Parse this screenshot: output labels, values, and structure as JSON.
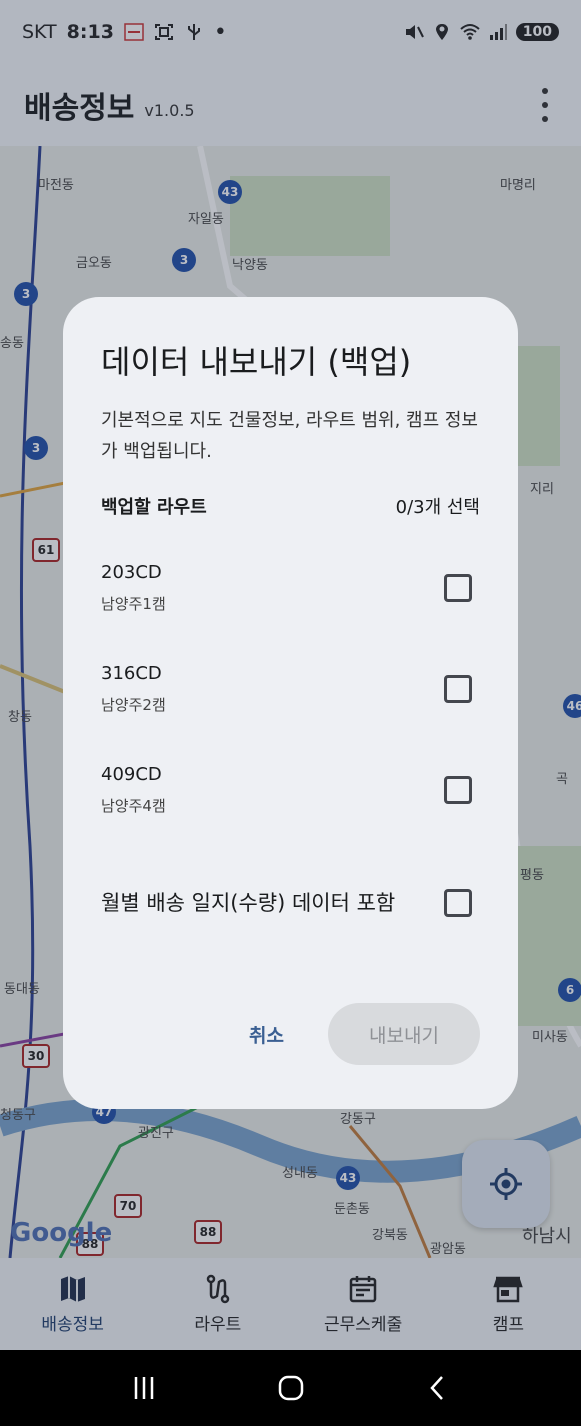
{
  "status_bar": {
    "carrier": "SKT",
    "time": "8:13",
    "battery": "100"
  },
  "app_bar": {
    "title": "배송정보",
    "version": "v1.0.5"
  },
  "map": {
    "labels": [
      "마전동",
      "자일동",
      "금오동",
      "낙양동",
      "마명리",
      "송동",
      "창동",
      "동대동",
      "광진구",
      "강동구",
      "성내동",
      "둔촌동",
      "강북동",
      "광암동",
      "미사동",
      "곡",
      "하남시",
      "지리",
      "평동",
      "청동구",
      "46",
      "6"
    ],
    "routes": [
      "43",
      "3",
      "3",
      "3",
      "43"
    ],
    "highways": [
      "61",
      "30",
      "70",
      "88",
      "88",
      "47"
    ],
    "google": "Google"
  },
  "dialog": {
    "title": "데이터 내보내기 (백업)",
    "description": "기본적으로 지도 건물정보, 라우트 범위, 캠프 정보가 백업됩니다.",
    "routes_label": "백업할 라우트",
    "selected_count": "0/3개 선택",
    "routes": [
      {
        "code": "203CD",
        "camp": "남양주1캠"
      },
      {
        "code": "316CD",
        "camp": "남양주2캠"
      },
      {
        "code": "409CD",
        "camp": "남양주4캠"
      }
    ],
    "monthly_label": "월별 배송 일지(수량) 데이터 포함",
    "cancel_label": "취소",
    "export_label": "내보내기"
  },
  "bottom_nav": [
    {
      "label": "배송정보",
      "icon": "map-icon"
    },
    {
      "label": "라우트",
      "icon": "route-icon"
    },
    {
      "label": "근무스케줄",
      "icon": "calendar-icon"
    },
    {
      "label": "캠프",
      "icon": "store-icon"
    }
  ]
}
